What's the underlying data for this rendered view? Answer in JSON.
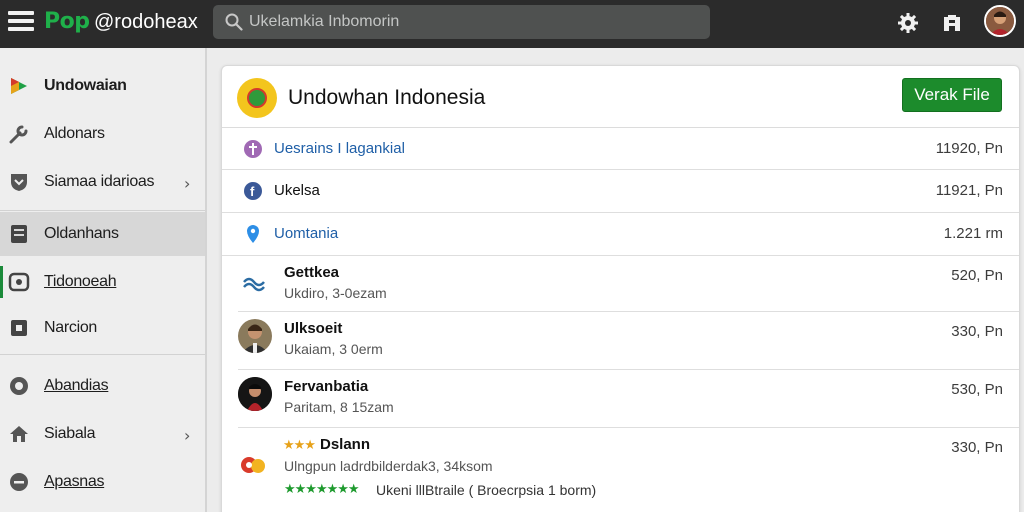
{
  "topbar": {
    "logo_text": "Pop",
    "brand": "@rodoheax",
    "search_placeholder": "Ukelamkia Inbomorin",
    "icons": [
      "menu-icon",
      "gear-icon",
      "notification-icon",
      "user-avatar"
    ]
  },
  "sidebar": {
    "items": [
      {
        "label": "Undowaian",
        "icon": "play-icon"
      },
      {
        "label": "Aldonars",
        "icon": "wrench-icon"
      },
      {
        "label": "Siamaa idarioas",
        "icon": "shield-icon"
      },
      {
        "label": "Oldanhans",
        "icon": "document-icon"
      },
      {
        "label": "Tidonoeah",
        "icon": "globe-icon"
      },
      {
        "label": "Narcion",
        "icon": "square-icon"
      },
      {
        "label": "Abandias",
        "icon": "settings-icon"
      },
      {
        "label": "Siabala",
        "icon": "home-icon"
      },
      {
        "label": "Apasnas",
        "icon": "minus-circle-icon"
      }
    ]
  },
  "main": {
    "title": "Undowhan Indonesia",
    "view_button": "Verak File",
    "rows": [
      {
        "name": "Uesrains I lagankial",
        "sub": "",
        "time": "11920, Pn",
        "icon": "purple-dot-icon"
      },
      {
        "name": "Ukelsa",
        "sub": "",
        "time": "11921, Pn",
        "icon": "facebook-icon"
      },
      {
        "name": "Uomtania",
        "sub": "",
        "time": "1.221 rm",
        "icon": "location-pin-icon"
      },
      {
        "name": "Gettkea",
        "sub": "Ukdiro, 3-0ezam",
        "time": "520, Pn",
        "icon": "link-icon"
      },
      {
        "name": "Ulksoeit",
        "sub": "Ukaiam, 3 0erm",
        "time": "330, Pn",
        "icon": "person-avatar"
      },
      {
        "name": "Fervanbatia",
        "sub": "Paritam, 8 15zam",
        "time": "530, Pn",
        "icon": "person-avatar-dark"
      },
      {
        "name": "Dslann",
        "sub": "Ulngpun ladrdbilderdak3, 34ksom",
        "rating_text": "Ukeni lllBtraile ( Broecrpsia 1 borm)",
        "time": "330, Pn",
        "icon": "red-badge-icon"
      }
    ]
  },
  "colors": {
    "topbar": "#2b2b2b",
    "accent_green": "#1c8b2c",
    "link_blue": "#1f5fa7",
    "star_yellow": "#e7a21a"
  }
}
